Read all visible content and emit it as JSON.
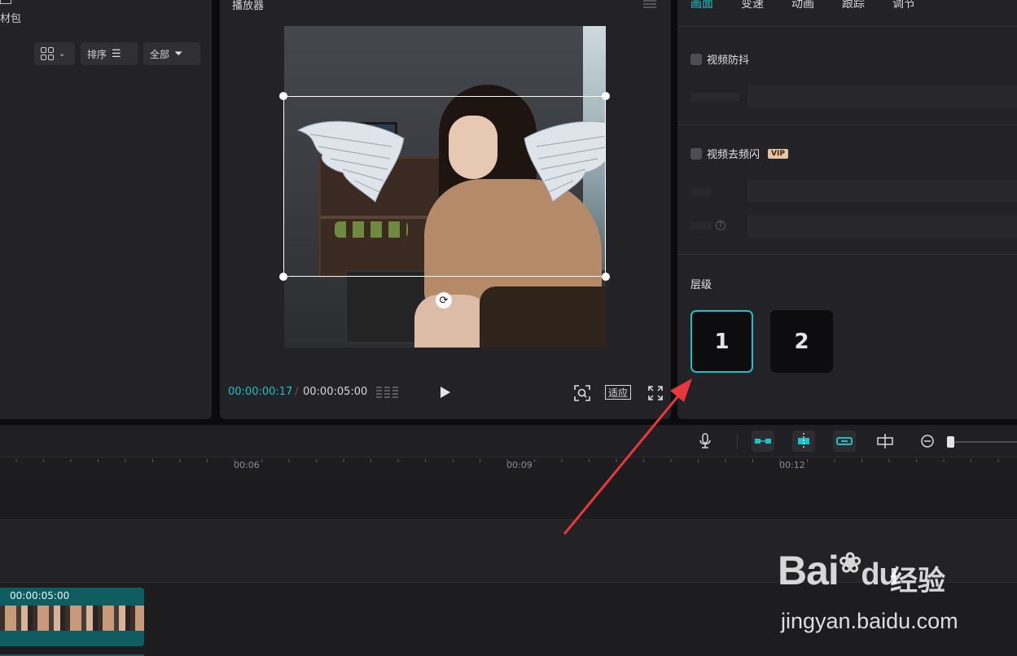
{
  "media_panel": {
    "label": "材包",
    "sort_label": "排序",
    "filter_label": "全部"
  },
  "player": {
    "title": "播放器",
    "current_time": "00:00:00:17",
    "separator": "/",
    "total_time": "00:00:05:00",
    "fit_label": "适应"
  },
  "inspector": {
    "tabs": [
      {
        "label": "画面",
        "active": true
      },
      {
        "label": "变速"
      },
      {
        "label": "动画"
      },
      {
        "label": "跟踪"
      },
      {
        "label": "调节"
      }
    ],
    "stabilize_label": "视频防抖",
    "deflicker_label": "视频去频闪",
    "vip_badge": "VIP",
    "help_glyph": "?",
    "level_title": "层级",
    "levels": [
      "1",
      "2"
    ]
  },
  "timeline": {
    "ticks": [
      "00:06",
      "00:09",
      "00:12"
    ],
    "clip_duration": "00:00:05:00"
  },
  "watermark": {
    "brand": "Bai",
    "brand_suffix": "du",
    "cn": "经验",
    "url": "jingyan.baidu.com"
  },
  "colors": {
    "accent": "#1ec0c8",
    "annotation_arrow": "#e8383d",
    "panel_bg": "#232327",
    "clip_bg": "#0f5d61"
  }
}
